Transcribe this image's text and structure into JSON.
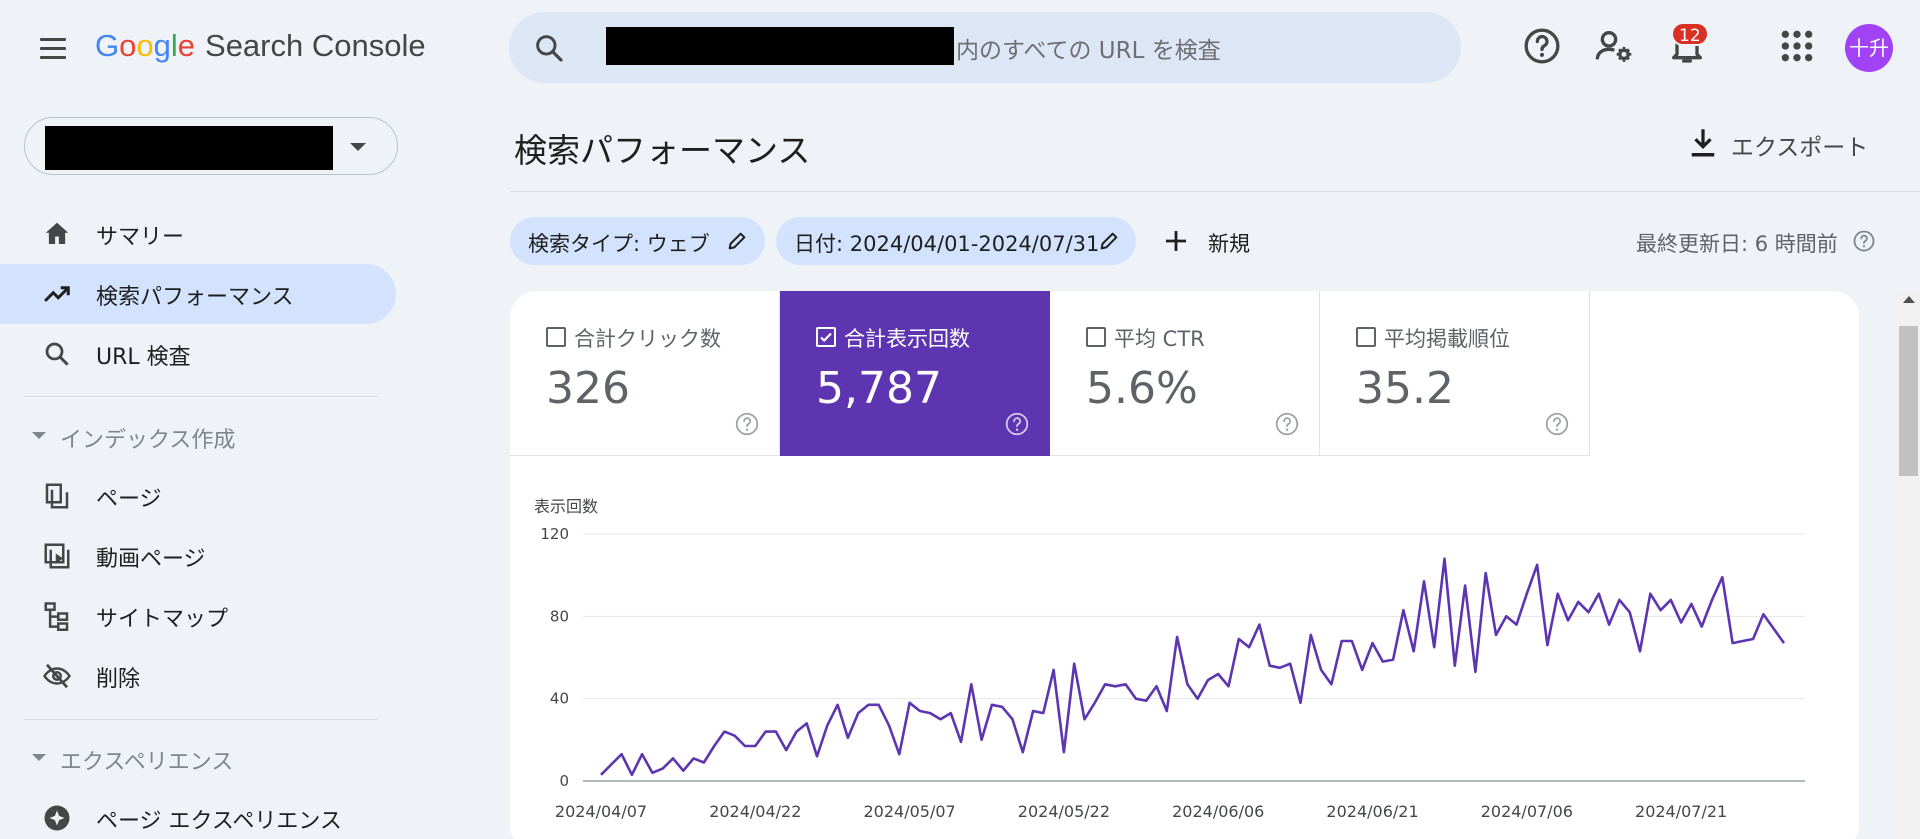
{
  "header": {
    "logo": {
      "letters": [
        "G",
        "o",
        "o",
        "g",
        "l",
        "e"
      ],
      "product": "Search Console"
    },
    "search": {
      "placeholder": "内のすべての URL を検査"
    },
    "notifications_count": "12",
    "avatar_text": "十升"
  },
  "sidebar": {
    "items": [
      {
        "label": "サマリー",
        "icon": "home-icon"
      },
      {
        "label": "検索パフォーマンス",
        "icon": "trending-up-icon",
        "active": true
      },
      {
        "label": "URL 検査",
        "icon": "search-icon"
      }
    ],
    "sections": [
      {
        "label": "インデックス作成",
        "items": [
          {
            "label": "ページ",
            "icon": "pages-icon"
          },
          {
            "label": "動画ページ",
            "icon": "video-page-icon"
          },
          {
            "label": "サイトマップ",
            "icon": "sitemap-icon"
          },
          {
            "label": "削除",
            "icon": "eye-off-icon"
          }
        ]
      },
      {
        "label": "エクスペリエンス",
        "items": [
          {
            "label": "ページ エクスペリエンス",
            "icon": "experience-icon"
          }
        ]
      }
    ]
  },
  "main": {
    "title": "検索パフォーマンス",
    "export_label": "エクスポート",
    "filters": {
      "search_type": "検索タイプ: ウェブ",
      "date": "日付: 2024/04/01-2024/07/31",
      "new_label": "新規"
    },
    "last_updated": "最終更新日: 6 時間前",
    "metrics": [
      {
        "label": "合計クリック数",
        "value": "326",
        "checked": false
      },
      {
        "label": "合計表示回数",
        "value": "5,787",
        "checked": true
      },
      {
        "label": "平均 CTR",
        "value": "5.6%",
        "checked": false
      },
      {
        "label": "平均掲載順位",
        "value": "35.2",
        "checked": false
      }
    ]
  },
  "colors": {
    "accent": "#5e35b1",
    "chip_bg": "#d3e3fd",
    "badge": "#d93025",
    "avatar": "#a142f4"
  },
  "chart_data": {
    "type": "line",
    "ylabel": "表示回数",
    "ylim": [
      0,
      120
    ],
    "yticks": [
      0,
      40,
      80,
      120
    ],
    "x_tick_labels": [
      "2024/04/07",
      "2024/04/22",
      "2024/05/07",
      "2024/05/22",
      "2024/06/06",
      "2024/06/21",
      "2024/07/06",
      "2024/07/21"
    ],
    "x_start": "2024/04/07",
    "x_end": "2024/07/31",
    "grid": true,
    "series": [
      {
        "color": "#5e35b1",
        "values": [
          3,
          8,
          13,
          3,
          13,
          4,
          6,
          11,
          5,
          11,
          9,
          17,
          24,
          22,
          17,
          17,
          24,
          24,
          15,
          24,
          28,
          12,
          27,
          37,
          21,
          33,
          37,
          37,
          27,
          13,
          38,
          34,
          33,
          30,
          33,
          19,
          47,
          20,
          37,
          36,
          30,
          14,
          34,
          33,
          54,
          14,
          57,
          30,
          38,
          47,
          46,
          47,
          40,
          39,
          46,
          34,
          70,
          47,
          40,
          49,
          52,
          46,
          69,
          65,
          76,
          56,
          55,
          57,
          38,
          71,
          54,
          47,
          68,
          68,
          54,
          67,
          58,
          59,
          83,
          63,
          97,
          65,
          108,
          56,
          95,
          53,
          101,
          71,
          80,
          76,
          91,
          105,
          66,
          91,
          78,
          87,
          82,
          91,
          76,
          88,
          82,
          63,
          91,
          83,
          88,
          77,
          86,
          75,
          88,
          99,
          67,
          68,
          69,
          81,
          74,
          67
        ]
      }
    ]
  }
}
